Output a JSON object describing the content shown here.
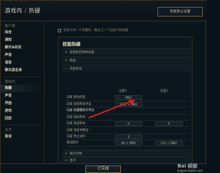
{
  "header": {
    "breadcrumb_root": "游戏内",
    "breadcrumb_sep": "/",
    "breadcrumb_page": "热键",
    "restore_button": "恢复默认设置"
  },
  "sidebar": {
    "group_client": "客户端",
    "client_items": [
      "综合",
      "通知",
      "聊天&好友",
      "声音",
      "语音",
      "聊天黑名单"
    ],
    "group_ingame": "游戏内",
    "ingame_items": [
      "热键",
      "声音",
      "界面",
      "游戏",
      "回放"
    ],
    "about_head": "关于",
    "about_items": [
      "验证"
    ]
  },
  "main": {
    "checkbox_label": "在按下另一个热键时，跳过上一个已按下的按键",
    "panel_title": "技能热键",
    "sections_top": [
      "技能和召唤师技能",
      "物品",
      "玩家移动"
    ],
    "col_head_1": "设置1",
    "col_head_2": "设置2",
    "rows": [
      {
        "name": "玩家 移动点击",
        "k1": "MB2",
        "k2": ""
      },
      {
        "name": "玩家 鼠标移动点击",
        "k1": "Shift + MB2",
        "k2": ""
      },
      {
        "name": "玩家 快捷键指令传达",
        "k1": "",
        "k2": ""
      },
      {
        "name": "玩家 鼠标移动",
        "k1": "",
        "k2": ""
      },
      {
        "name": "玩家 攻击移动",
        "k1": "A",
        "k2": "X"
      },
      {
        "name": "玩家 攻击中移动",
        "k1": "",
        "k2": ""
      },
      {
        "name": "玩家 停止动作",
        "k1": "S",
        "k2": ""
      },
      {
        "name": "移动指令",
        "k1": "Alt + MB2",
        "k2": "Ctrl + MB2"
      }
    ],
    "sections_bottom": [
      "镜头控制",
      "显示"
    ]
  },
  "footer": {
    "done_button": "已完成"
  },
  "watermark": {
    "brand": "Bai 经验",
    "url": "jingyan.baidu.com"
  },
  "colors": {
    "accent_gold": "#c8aa6e",
    "arrow_red": "#e01e1e"
  }
}
